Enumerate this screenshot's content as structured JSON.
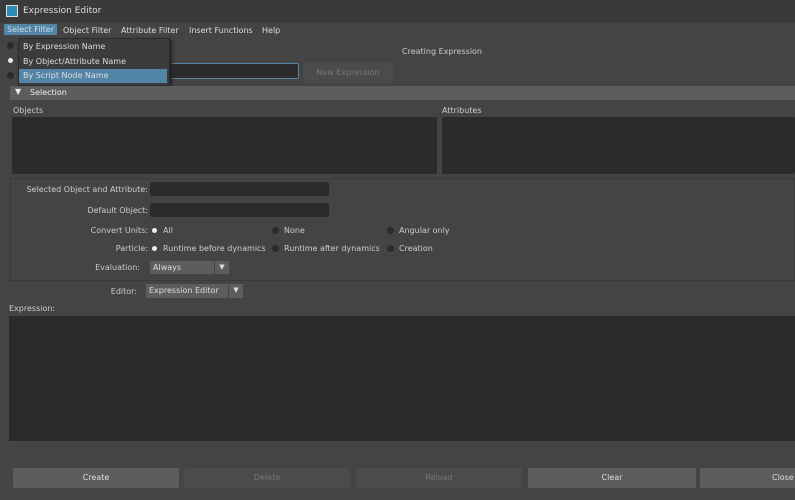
{
  "window": {
    "title": "Expression Editor"
  },
  "menu": [
    "Select Filter",
    "Object Filter",
    "Attribute Filter",
    "Insert Functions",
    "Help"
  ],
  "select_filter_menu": {
    "items": [
      "By Expression Name",
      "By Object/Attribute Name",
      "By Script Node Name"
    ],
    "checked_index": 1,
    "highlighted_index": 2
  },
  "status": "Creating Expression",
  "name_input": {
    "value": ""
  },
  "new_expression_label": "New Expression",
  "selection": {
    "header": "Selection",
    "objects_label": "Objects",
    "attributes_label": "Attributes"
  },
  "form": {
    "selected_label": "Selected Object and Attribute:",
    "selected_value": "",
    "default_label": "Default Object:",
    "default_value": "",
    "convert_label": "Convert Units:",
    "convert_options": [
      "All",
      "None",
      "Angular only"
    ],
    "convert_selected": "All",
    "particle_label": "Particle:",
    "particle_options": [
      "Runtime before dynamics",
      "Runtime after dynamics",
      "Creation"
    ],
    "particle_selected": "Runtime before dynamics",
    "evaluation_label": "Evaluation:",
    "evaluation_value": "Always",
    "editor_label": "Editor:",
    "editor_value": "Expression Editor"
  },
  "expression": {
    "label": "Expression:",
    "value": ""
  },
  "buttons": {
    "create": "Create",
    "delete": "Delete",
    "reload": "Reload",
    "clear": "Clear",
    "close": "Close"
  },
  "colors": {
    "highlight": "#5285a6",
    "background": "#444444"
  }
}
